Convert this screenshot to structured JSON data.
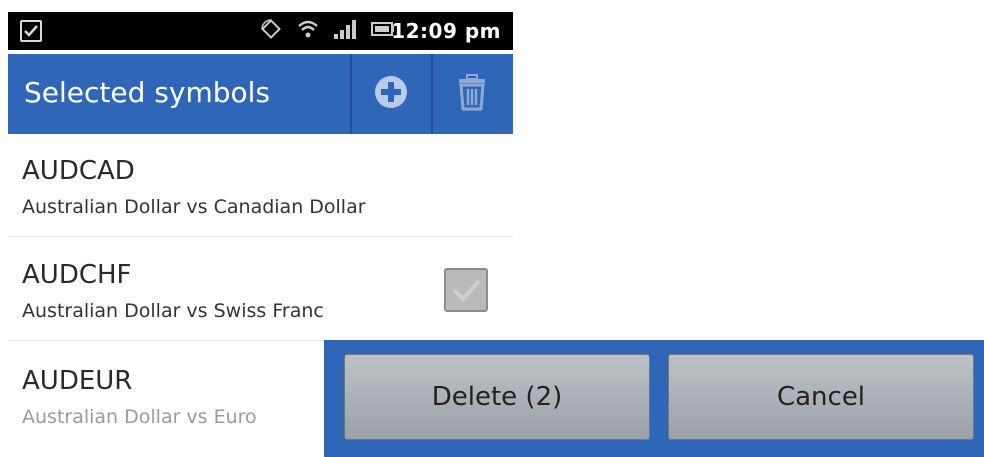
{
  "status_bar": {
    "time": "12:09 pm",
    "icons": [
      "notification-check-icon",
      "rotate-icon",
      "wifi-icon",
      "signal-icon",
      "battery-icon"
    ]
  },
  "action_bar": {
    "title": "Selected symbols",
    "add_icon": "add-circle-icon",
    "delete_icon": "trash-icon",
    "color": "#2f66b8"
  },
  "symbols": [
    {
      "symbol": "AUDCAD",
      "description": "Australian Dollar vs Canadian Dollar"
    },
    {
      "symbol": "AUDCHF",
      "description": "Australian Dollar vs Swiss Franc"
    },
    {
      "symbol": "AUDEUR",
      "description": "Australian Dollar vs Euro"
    }
  ],
  "bottom_buttons": {
    "delete_label": "Delete (2)",
    "cancel_label": "Cancel"
  }
}
